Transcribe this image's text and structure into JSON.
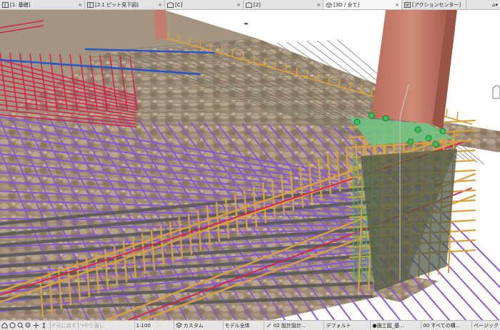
{
  "tabs": [
    {
      "label": "[1. 基礎]",
      "icon": "floorplan-icon",
      "active": false
    },
    {
      "label": "[2.1 ピット見下図]",
      "icon": "floorplan-icon",
      "active": false
    },
    {
      "label": "[C]",
      "icon": "section-icon",
      "active": false
    },
    {
      "label": "[2]",
      "icon": "section-icon",
      "active": false
    },
    {
      "label": "[3D / 全て]",
      "icon": "3d-view-icon",
      "active": true
    },
    {
      "label": "[アクションセンター]",
      "icon": "action-center-icon",
      "active": false
    }
  ],
  "tab_close_glyph": "×",
  "tab_tail_glyph": "⌂▾",
  "nav_arrow": "◂▸",
  "statusbar": {
    "undo_label": "元に戻す",
    "redo_label": "やり直し",
    "scale": "1:100",
    "layer_combo": "カスタム",
    "model_view": "モデル全体",
    "pen_set": "02 設計設計...",
    "dimension": "デフォルト",
    "renovation": "●施工図_基...",
    "partial_structure": "00 すべての構...",
    "page_label": "ページック"
  },
  "colors": {
    "tab_bg": "#e3e3e3",
    "statusbar_bg": "#e6e6e6",
    "rebar_purple": "#8a5ad0",
    "rebar_orange": "#d7a040",
    "rebar_red": "#d82050",
    "rebar_gray": "#5a5a5a",
    "steel_column": "#c77c6c",
    "anchor_green": "#39c05a",
    "blue_bar": "#2a55c8"
  }
}
